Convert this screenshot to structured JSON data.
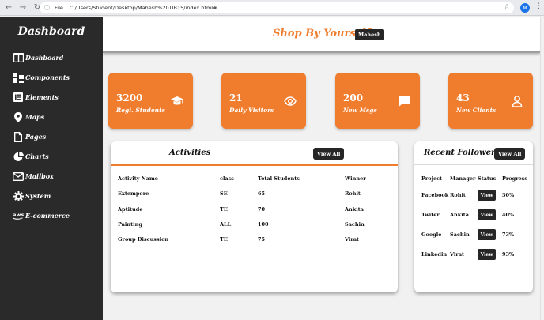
{
  "browser": {
    "file_label": "File",
    "url": "C:/Users/Student/Desktop/Mahesh%20TIB15/index.html#",
    "profile_initial": "M"
  },
  "sidebar": {
    "title": "Dashboard",
    "items": [
      {
        "label": "Dashboard",
        "icon": "columns-icon"
      },
      {
        "label": "Components",
        "icon": "components-icon"
      },
      {
        "label": "Elements",
        "icon": "elements-icon"
      },
      {
        "label": "Maps",
        "icon": "map-pin-icon"
      },
      {
        "label": "Pages",
        "icon": "pages-icon"
      },
      {
        "label": "Charts",
        "icon": "pie-chart-icon"
      },
      {
        "label": "Mailbox",
        "icon": "mailbox-icon"
      },
      {
        "label": "System",
        "icon": "gear-icon"
      },
      {
        "label": "E-commerce",
        "icon": "aws-icon"
      }
    ]
  },
  "header": {
    "brand": "Shop By Yourself",
    "user": "Mahesh"
  },
  "stats": [
    {
      "value": "3200",
      "label": "Regi. Students",
      "icon": "graduation-cap-icon"
    },
    {
      "value": "21",
      "label": "Daily Visitors",
      "icon": "eye-icon"
    },
    {
      "value": "200",
      "label": "New Msgs",
      "icon": "message-icon"
    },
    {
      "value": "43",
      "label": "New Clients",
      "icon": "user-icon"
    }
  ],
  "activities": {
    "title": "Activities",
    "view_all": "View All",
    "columns": [
      "Activity Name",
      "class",
      "Total Students",
      "Winner"
    ],
    "rows": [
      [
        "Extempore",
        "SE",
        "65",
        "Rohit"
      ],
      [
        "Aptitude",
        "TE",
        "70",
        "Ankita"
      ],
      [
        "Painting",
        "ALL",
        "100",
        "Sachin"
      ],
      [
        "Group Discussion",
        "TE",
        "75",
        "Virat"
      ]
    ]
  },
  "followers": {
    "title": "Recent Followers",
    "view_all": "View All",
    "columns": [
      "Project",
      "Manager",
      "Status",
      "Progress"
    ],
    "rows": [
      {
        "project": "Facebook",
        "manager": "Rohit",
        "status": "View",
        "progress": "30%"
      },
      {
        "project": "Twiter",
        "manager": "Ankita",
        "status": "View",
        "progress": "40%"
      },
      {
        "project": "Google",
        "manager": "Sachin",
        "status": "View",
        "progress": "73%"
      },
      {
        "project": "Linkedin",
        "manager": "Virat",
        "status": "View",
        "progress": "93%"
      }
    ]
  },
  "colors": {
    "accent": "#f07d2e",
    "sidebar": "#2a2a2a",
    "dark_button": "#262626"
  }
}
